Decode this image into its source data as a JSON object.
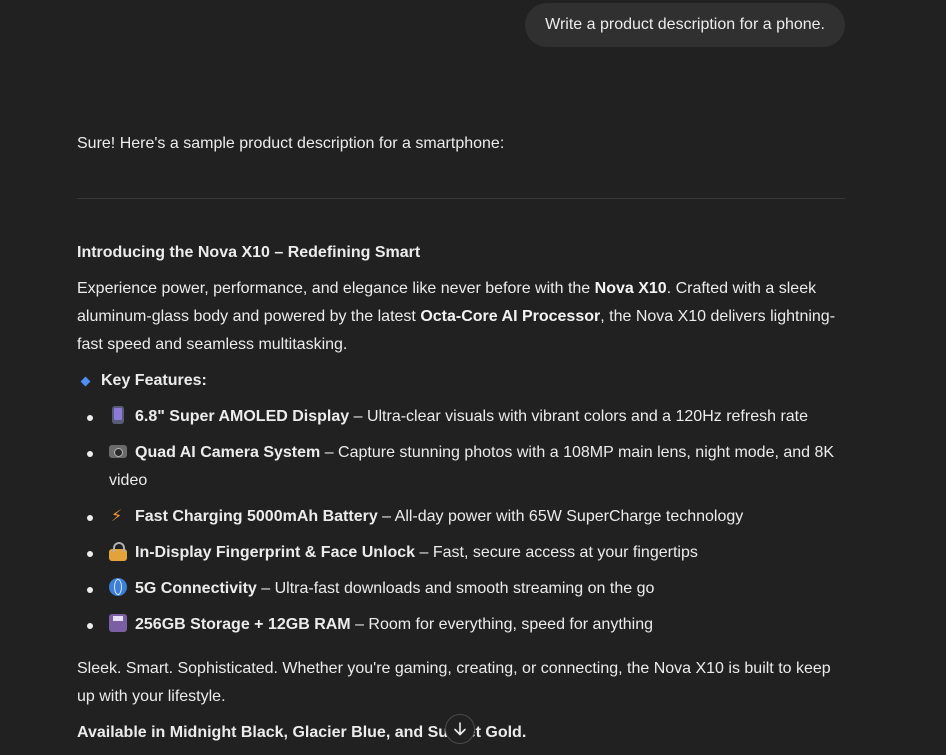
{
  "user_message": "Write a product description for a phone.",
  "assistant": {
    "intro": "Sure! Here's a sample product description for a smartphone:",
    "heading": "Introducing the Nova X10 – Redefining Smart",
    "para1": {
      "t1": "Experience power, performance, and elegance like never before with the ",
      "b1": "Nova X10",
      "t2": ". Crafted with a sleek aluminum-glass body and powered by the latest ",
      "b2": "Octa-Core AI Processor",
      "t3": ", the Nova X10 delivers lightning-fast speed and seamless multitasking."
    },
    "key_features_label": "Key Features:",
    "features": [
      {
        "icon": "phone-icon",
        "title": "6.8\" Super AMOLED Display",
        "desc": " – Ultra-clear visuals with vibrant colors and a 120Hz refresh rate"
      },
      {
        "icon": "camera-icon",
        "title": "Quad AI Camera System",
        "desc": " – Capture stunning photos with a 108MP main lens, night mode, and 8K video"
      },
      {
        "icon": "lightning-icon",
        "title": "Fast Charging 5000mAh Battery",
        "desc": " – All-day power with 65W SuperCharge technology"
      },
      {
        "icon": "lock-icon",
        "title": "In-Display Fingerprint & Face Unlock",
        "desc": " – Fast, secure access at your fingertips"
      },
      {
        "icon": "globe-icon",
        "title": "5G Connectivity",
        "desc": " – Ultra-fast downloads and smooth streaming on the go"
      },
      {
        "icon": "floppy-disk-icon",
        "title": "256GB Storage + 12GB RAM",
        "desc": " – Room for everything, speed for anything"
      }
    ],
    "para2": "Sleek. Smart. Sophisticated. Whether you're gaming, creating, or connecting, the Nova X10 is built to keep up with your lifestyle.",
    "availability": "Available in Midnight Black, Glacier Blue, and Sunset Gold."
  },
  "colors": {
    "background": "#212121",
    "user_bubble": "#303030",
    "text": "#ececec",
    "diamond_accent": "#4f8ef7"
  }
}
